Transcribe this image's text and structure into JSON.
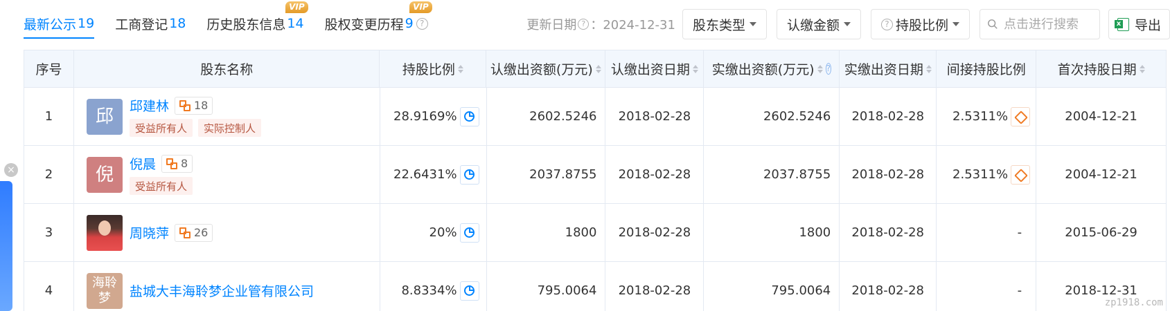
{
  "tabs": [
    {
      "label": "最新公示",
      "count": "19",
      "vip": ""
    },
    {
      "label": "工商登记",
      "count": "18",
      "vip": ""
    },
    {
      "label": "历史股东信息",
      "count": "14",
      "vip": "VIP"
    },
    {
      "label": "股权变更历程",
      "count": "9",
      "vip": "VIP"
    }
  ],
  "toolbar": {
    "update_prefix": "更新日期",
    "update_date": "：2024-12-31",
    "filter_type": "股东类型",
    "filter_amount": "认缴金额",
    "filter_ratio": "持股比例",
    "search_placeholder": "点击进行搜索",
    "export_label": "导出"
  },
  "table": {
    "headers": [
      "序号",
      "股东名称",
      "持股比例",
      "认缴出资额(万元)",
      "认缴出资日期",
      "实缴出资额(万元)",
      "实缴出资日期",
      "间接持股比例",
      "首次持股日期"
    ],
    "rows": [
      {
        "index": "1",
        "avatar": "邱",
        "avatar_color": "#8aa3cf",
        "name": "邱建林",
        "rel_count": "18",
        "tags": [
          "受益所有人",
          "实际控制人"
        ],
        "ratio": "28.9169%",
        "sub_amount": "2602.5246",
        "sub_date": "2018-02-28",
        "paid_amount": "2602.5246",
        "paid_date": "2018-02-28",
        "indirect": "2.5311%",
        "first_date": "2004-12-21"
      },
      {
        "index": "2",
        "avatar": "倪",
        "avatar_color": "#cf8080",
        "name": "倪晨",
        "rel_count": "8",
        "tags": [
          "受益所有人"
        ],
        "ratio": "22.6431%",
        "sub_amount": "2037.8755",
        "sub_date": "2018-02-28",
        "paid_amount": "2037.8755",
        "paid_date": "2018-02-28",
        "indirect": "2.5311%",
        "first_date": "2004-12-21"
      },
      {
        "index": "3",
        "avatar": "",
        "avatar_color": "",
        "name": "周晓萍",
        "rel_count": "26",
        "tags": [],
        "ratio": "20%",
        "sub_amount": "1800",
        "sub_date": "2018-02-28",
        "paid_amount": "1800",
        "paid_date": "2018-02-28",
        "indirect": "-",
        "first_date": "2015-06-29"
      },
      {
        "index": "4",
        "avatar": "海聆梦",
        "avatar_color": "#d1a88f",
        "name": "盐城大丰海聆梦企业管有限公司",
        "rel_count": "",
        "tags": [],
        "ratio": "8.8334%",
        "sub_amount": "795.0064",
        "sub_date": "2018-02-28",
        "paid_amount": "795.0064",
        "paid_date": "2018-02-28",
        "indirect": "-",
        "first_date": "2018-12-31"
      }
    ]
  },
  "watermark": "zp1918.com"
}
